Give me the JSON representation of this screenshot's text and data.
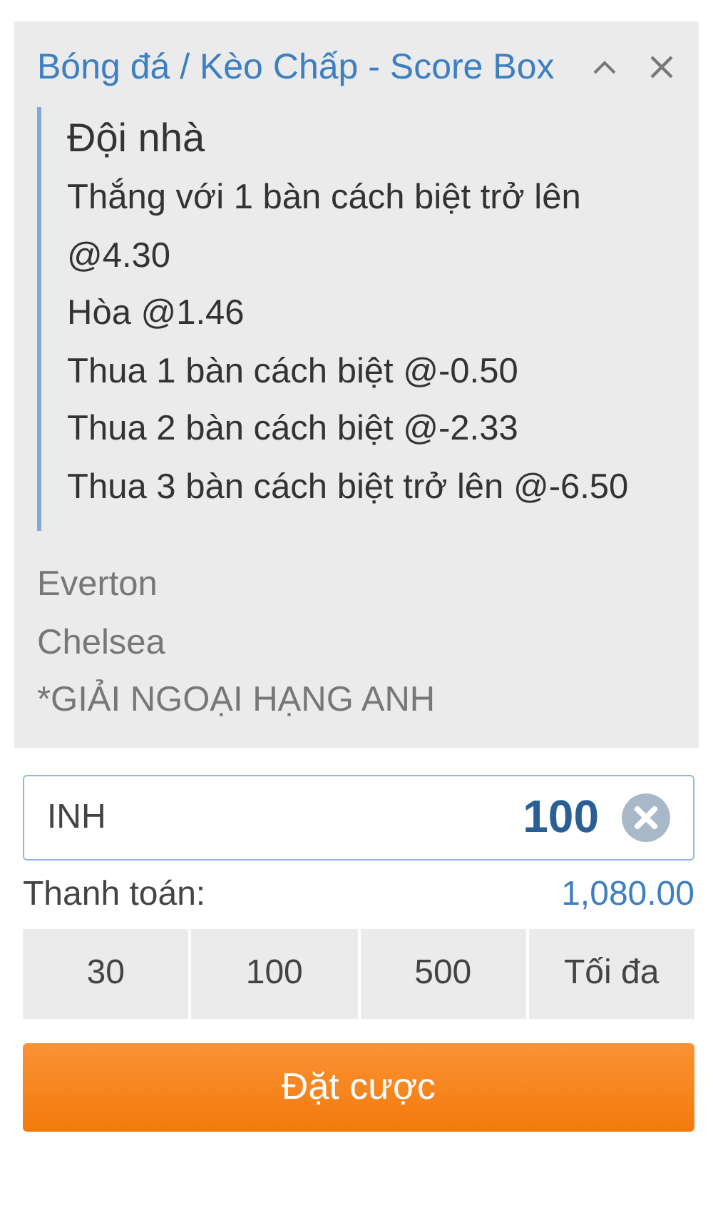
{
  "bet_slip": {
    "title": "Bóng đá / Kèo Chấp - Score Box",
    "selection": {
      "heading": "Đội nhà",
      "options": [
        "Thắng với 1 bàn cách biệt trở lên @4.30",
        "Hòa @1.46",
        "Thua 1 bàn cách biệt @-0.50",
        "Thua 2 bàn cách biệt @-2.33",
        "Thua 3 bàn cách biệt trở lên @-6.50"
      ]
    },
    "match": [
      "Everton",
      "Chelsea",
      "*GIẢI NGOẠI HẠNG ANH"
    ]
  },
  "stake": {
    "currency": "INH",
    "value": "100"
  },
  "payout": {
    "label": "Thanh toán:",
    "value": "1,080.00"
  },
  "quick_stakes": [
    "30",
    "100",
    "500",
    "Tối đa"
  ],
  "submit": "Đặt cược"
}
